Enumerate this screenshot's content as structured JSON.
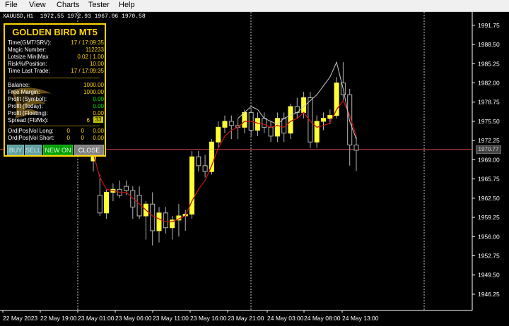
{
  "menu": [
    "File",
    "View",
    "Charts",
    "Tester",
    "Help"
  ],
  "symbol_info": "XAUUSD,H1  1972.55 1972.93 1967.06 1970.58",
  "chart_data": {
    "type": "candlestick",
    "symbol": "XAUUSD",
    "timeframe": "H1",
    "ohlc_header": {
      "open": 1972.55,
      "high": 1972.93,
      "low": 1967.06,
      "close": 1970.58
    },
    "y_ticks": [
      1991.75,
      1988.5,
      1985.25,
      1982.0,
      1978.75,
      1975.5,
      1972.25,
      1969.0,
      1965.75,
      1962.5,
      1959.25,
      1956.0,
      1952.75,
      1949.5,
      1946.25
    ],
    "x_labels": [
      "22 May 2023",
      "22 May 19:00",
      "23 May 01:00",
      "23 May 06:00",
      "23 May 11:00",
      "23 May 16:00",
      "23 May 21:00",
      "24 May 03:00",
      "24 May 08:00",
      "24 May 13:00"
    ],
    "current_price_label": "1970.77",
    "current_price": 1970.77,
    "ylim": [
      1943.5,
      1994.0
    ],
    "candles": [
      {
        "o": 1968.8,
        "h": 1971.0,
        "l": 1967.0,
        "c": 1969.8
      },
      {
        "o": 1963.0,
        "h": 1966.5,
        "l": 1959.5,
        "c": 1960.0
      },
      {
        "o": 1960.0,
        "h": 1964.0,
        "l": 1959.0,
        "c": 1963.5
      },
      {
        "o": 1963.5,
        "h": 1965.0,
        "l": 1962.0,
        "c": 1964.0
      },
      {
        "o": 1964.0,
        "h": 1965.5,
        "l": 1962.5,
        "c": 1963.0
      },
      {
        "o": 1964.5,
        "h": 1965.5,
        "l": 1963.0,
        "c": 1963.8
      },
      {
        "o": 1963.8,
        "h": 1964.5,
        "l": 1959.0,
        "c": 1961.0
      },
      {
        "o": 1963.0,
        "h": 1964.5,
        "l": 1959.0,
        "c": 1959.5
      },
      {
        "o": 1959.5,
        "h": 1962.0,
        "l": 1955.5,
        "c": 1961.5
      },
      {
        "o": 1961.5,
        "h": 1963.5,
        "l": 1954.5,
        "c": 1957.0
      },
      {
        "o": 1957.0,
        "h": 1961.0,
        "l": 1955.0,
        "c": 1960.0
      },
      {
        "o": 1960.0,
        "h": 1961.0,
        "l": 1956.5,
        "c": 1957.5
      },
      {
        "o": 1957.5,
        "h": 1959.5,
        "l": 1955.5,
        "c": 1958.8
      },
      {
        "o": 1958.8,
        "h": 1961.5,
        "l": 1956.0,
        "c": 1959.5
      },
      {
        "o": 1959.5,
        "h": 1960.5,
        "l": 1957.0,
        "c": 1959.8
      },
      {
        "o": 1959.8,
        "h": 1970.5,
        "l": 1959.0,
        "c": 1969.5
      },
      {
        "o": 1969.5,
        "h": 1970.5,
        "l": 1967.0,
        "c": 1968.0
      },
      {
        "o": 1968.0,
        "h": 1969.8,
        "l": 1966.0,
        "c": 1967.0
      },
      {
        "o": 1967.0,
        "h": 1972.5,
        "l": 1966.5,
        "c": 1972.0
      },
      {
        "o": 1972.0,
        "h": 1975.5,
        "l": 1971.0,
        "c": 1974.5
      },
      {
        "o": 1974.5,
        "h": 1976.5,
        "l": 1973.5,
        "c": 1975.5
      },
      {
        "o": 1975.5,
        "h": 1976.5,
        "l": 1972.5,
        "c": 1974.8
      },
      {
        "o": 1974.8,
        "h": 1976.0,
        "l": 1972.5,
        "c": 1974.5
      },
      {
        "o": 1974.5,
        "h": 1977.5,
        "l": 1973.5,
        "c": 1977.0
      },
      {
        "o": 1977.0,
        "h": 1977.5,
        "l": 1973.0,
        "c": 1974.0
      },
      {
        "o": 1974.0,
        "h": 1977.0,
        "l": 1973.0,
        "c": 1976.0
      },
      {
        "o": 1976.0,
        "h": 1977.0,
        "l": 1973.5,
        "c": 1974.5
      },
      {
        "o": 1974.5,
        "h": 1975.5,
        "l": 1972.0,
        "c": 1973.0
      },
      {
        "o": 1973.0,
        "h": 1977.0,
        "l": 1972.0,
        "c": 1976.0
      },
      {
        "o": 1976.0,
        "h": 1977.0,
        "l": 1972.0,
        "c": 1973.5
      },
      {
        "o": 1973.5,
        "h": 1978.5,
        "l": 1972.5,
        "c": 1978.0
      },
      {
        "o": 1978.0,
        "h": 1979.5,
        "l": 1976.0,
        "c": 1977.0
      },
      {
        "o": 1977.0,
        "h": 1980.5,
        "l": 1976.0,
        "c": 1979.5
      },
      {
        "o": 1979.5,
        "h": 1980.5,
        "l": 1971.0,
        "c": 1972.0
      },
      {
        "o": 1972.0,
        "h": 1976.5,
        "l": 1971.0,
        "c": 1975.5
      },
      {
        "o": 1975.5,
        "h": 1977.0,
        "l": 1974.0,
        "c": 1976.0
      },
      {
        "o": 1976.0,
        "h": 1977.5,
        "l": 1975.0,
        "c": 1976.5
      },
      {
        "o": 1976.5,
        "h": 1983.0,
        "l": 1976.0,
        "c": 1982.0
      },
      {
        "o": 1982.0,
        "h": 1985.5,
        "l": 1979.0,
        "c": 1980.0
      },
      {
        "o": 1980.0,
        "h": 1981.0,
        "l": 1968.0,
        "c": 1971.5
      },
      {
        "o": 1971.5,
        "h": 1972.9,
        "l": 1967.1,
        "c": 1970.6
      }
    ],
    "ma_line": [
      1970,
      1966,
      1964,
      1963.8,
      1963.5,
      1963.5,
      1962.5,
      1961.5,
      1960.5,
      1959.5,
      1959.0,
      1958.5,
      1958.5,
      1959.0,
      1959.5,
      1962.0,
      1964.0,
      1965.5,
      1968.0,
      1971.0,
      1973.0,
      1974.0,
      1974.5,
      1975.5,
      1975.5,
      1975.2,
      1975.0,
      1974.5,
      1974.8,
      1974.5,
      1975.5,
      1976.0,
      1977.0,
      1975.5,
      1974.5,
      1974.8,
      1975.2,
      1977.5,
      1979.0,
      1976.5,
      1973.0
    ],
    "signal_line": [
      1976.0,
      1977.0,
      1978.0,
      1977.5,
      1976.0,
      1975.5,
      1975.0,
      1976.0,
      1976.5,
      1977.0,
      1978.0,
      1979.0,
      1980.0,
      1981.5,
      1983.0,
      1985.5,
      1981.0,
      1975.5,
      1972.5
    ],
    "signal_start": 22
  },
  "ea_panel": {
    "title": "GOLDEN BIRD MT5",
    "rows1": [
      {
        "label": "Time(GMT/SRV):",
        "value": "17 / 17:09:35"
      },
      {
        "label": "Magic Number:",
        "value": "112233"
      },
      {
        "label": "Lotsize Min|Max",
        "value": "0.02 | 1.00"
      },
      {
        "label": "Risk%/Position:",
        "value": "10.00"
      },
      {
        "label": "Time Last Trade:",
        "value": "17 / 17:09:35"
      }
    ],
    "rows2": [
      {
        "label": "Balance:",
        "value": "1000.00",
        "green": false
      },
      {
        "label": "Free Margin:",
        "value": "1000.00",
        "green": false
      },
      {
        "label": "Profit (Symbol):",
        "value": "0.00",
        "green": true
      },
      {
        "label": "Profit (Today):",
        "value": "0.00",
        "green": true
      },
      {
        "label": "Profit (Floating):",
        "value": "0.00",
        "green": false
      }
    ],
    "spread_label": "Spread (Flt/Mx):",
    "spread_value": "6",
    "spread_max": "33",
    "long_label": "Ord|Pos|Vol Long:",
    "short_label": "Ord|Pos|Vol Short:",
    "long_values": [
      "0",
      "0",
      "0.00"
    ],
    "short_values": [
      "0",
      "0",
      "0.00"
    ],
    "buttons": {
      "buy": "BUY",
      "sell": "SELL",
      "new_on": "NEW ON",
      "close": "CLOSE"
    }
  },
  "colors": {
    "candle": "#ffff33",
    "wick": "#b5b5b5",
    "ma": "#c01010",
    "signal_line": "#c8c8c8",
    "price_line": "#c84040",
    "panel_accent": "#ffd700",
    "green_button": "#00a000",
    "blue_button": "#5f9ea0",
    "grey_button": "#808080"
  }
}
